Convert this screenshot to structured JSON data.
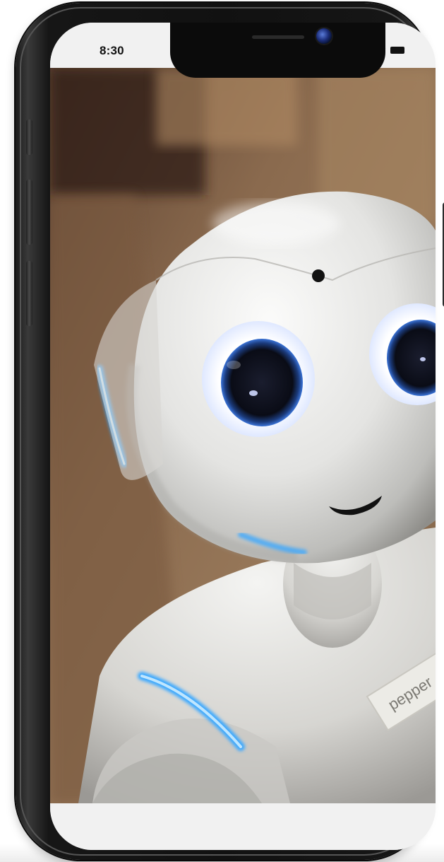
{
  "status_bar": {
    "time": "8:30"
  },
  "photo": {
    "label_text": "pepper"
  },
  "colors": {
    "accent_glow": "#3aa8ff",
    "background": "#ffffff",
    "phone_frame": "#111111",
    "screen_bg": "#f1f1f1"
  }
}
